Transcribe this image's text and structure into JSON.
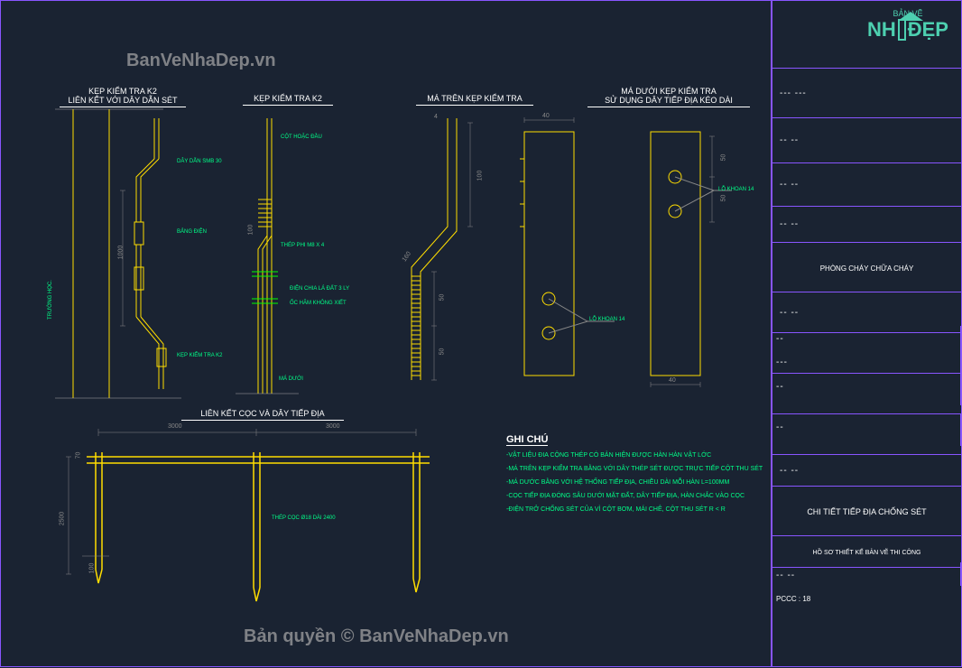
{
  "watermarks": {
    "top": "BanVeNhaDep.vn",
    "bottom": "Bản quyền © BanVeNhaDep.vn"
  },
  "logo": {
    "topline": "BẢN VẼ",
    "left": "NH",
    "right": "ĐẸP"
  },
  "titles": {
    "detail1_line1": "KẸP KIỂM TRA K2",
    "detail1_line2": "LIÊN KẾT VỚI DÂY DẪN SÉT",
    "detail2": "KẸP KIỂM TRA K2",
    "detail3": "MÁ TRÊN KẸP KIỂM TRA",
    "detail4_line1": "MÁ DƯỚI KẸP KIỂM TRA",
    "detail4_line2": "SỬ DỤNG DÂY TIẾP ĐỊA KÉO DÀI",
    "detail5": "LIÊN KẾT CỌC VÀ DÂY TIẾP ĐỊA"
  },
  "labels": {
    "day_dan": "DÂY DẪN SMB 30",
    "bang_dien": "BẢNG ĐIỆN",
    "truong_hoc": "TRƯỜNG HỌC.",
    "kep_kiem_tra": "KẸP KIỂM TRA K2",
    "cot_hoac_dau": "CỘT HOẶC ĐẦU",
    "thep_phi": "THÉP PHI M8 X 4",
    "dien_chia": "ĐIỆN CHIA LÁ ĐẤT 3 LY",
    "ti_so": "ỐC HÃM KHÔNG XIẾT",
    "ma_duoi": "MÁ DƯỚI",
    "lo_khoan_14": "LỖ KHOAN 14",
    "lo_khoan_14b": "LỖ KHOAN 14",
    "thep_coc": "THÉP CỌC Ø18 DÀI 2400"
  },
  "dims": {
    "d100": "100",
    "d1000": "1000",
    "d50": "50",
    "d40": "40",
    "d40b": "40",
    "d50b": "50",
    "d3000a": "3000",
    "d3000b": "3000",
    "d2500": "2500",
    "d70": "70",
    "d100b": "100",
    "d4": "4"
  },
  "ghi_chu": {
    "title": "GHI CHÚ",
    "line1": "-VẬT LIỆU ĐIA CỘNG THÉP CÓ BẢN HIỆN ĐƯỢC HÀN HÀN VẬT LỚC",
    "line2": "-MÁ TRÊN KẸP KIỂM TRA BẰNG VỚI DÂY THÉP SÉT ĐƯỢC TRỰC TIẾP CỘT THU SÉT",
    "line3": "-MÁ DƯỚC BẰNG VỚI HỆ THỐNG TIẾP ĐỊA, CHIỀU DÀI MỖI HÀN L=100MM",
    "line4": "-CỌC TIẾP ĐỊA ĐÓNG SÂU DƯỚI MẶT ĐẤT, DÂY TIẾP ĐỊA, HÀN CHẮC VÀO CỌC",
    "line5": "-ĐIỆN TRỞ CHỐNG SÉT CỦA VÌ CỘT BƠM, MÁI CHÊ, CỘT THU SÉT R < R"
  },
  "title_block": {
    "row_phong_chay": "PHÒNG CHÁY CHỮA CHÁY",
    "row_drawing_title": "CHI TIẾT TIẾP ĐỊA CHỐNG SÉT",
    "row_doc_type": "HỒ SƠ THIẾT KẾ BẢN VẼ THI CÔNG",
    "row_sheet_label": "PCCC : 18"
  }
}
